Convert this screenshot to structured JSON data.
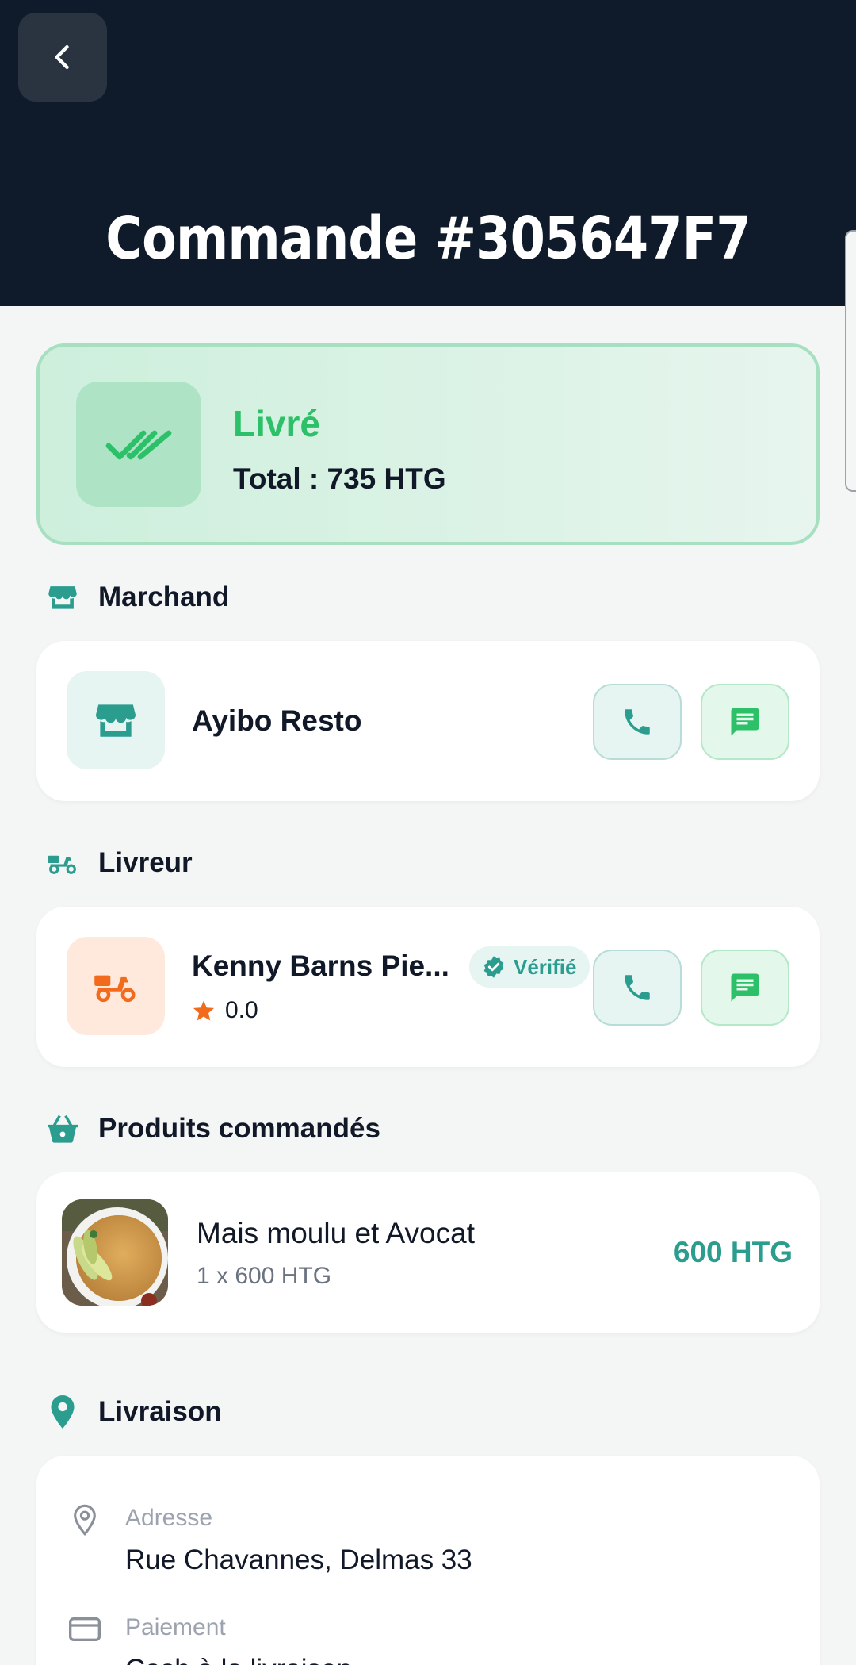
{
  "header": {
    "title": "Commande #305647F7"
  },
  "status": {
    "label": "Livré",
    "total": "Total : 735 HTG"
  },
  "merchant_section": {
    "heading": "Marchand",
    "name": "Ayibo Resto"
  },
  "driver_section": {
    "heading": "Livreur",
    "name": "Kenny Barns Pie...",
    "badge": "Vérifié",
    "rating": "0.0"
  },
  "products_section": {
    "heading": "Produits commandés",
    "items": [
      {
        "name": "Mais moulu et Avocat",
        "qty": "1 x 600 HTG",
        "price": "600 HTG"
      }
    ]
  },
  "delivery_section": {
    "heading": "Livraison",
    "address_label": "Adresse",
    "address_value": "Rue Chavannes, Delmas 33",
    "payment_label": "Paiement",
    "payment_value": "Cash à la livraison"
  },
  "colors": {
    "header_bg": "#0f1a2b",
    "accent_teal": "#2a9d8f",
    "success_green": "#2cc069",
    "driver_orange": "#f26b1d"
  }
}
